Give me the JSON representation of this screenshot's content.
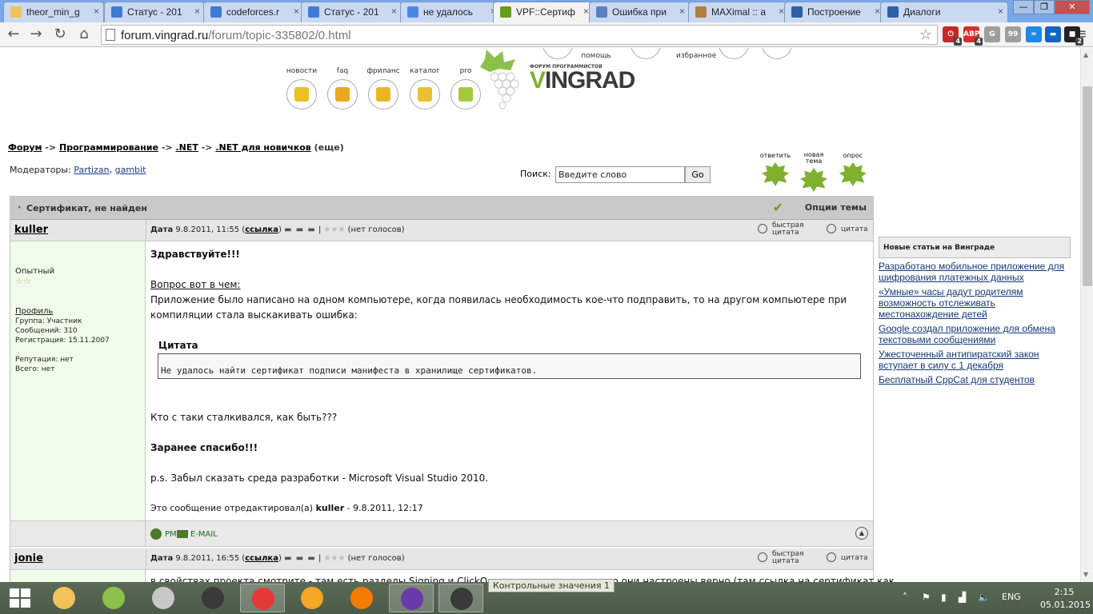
{
  "browser": {
    "tabs": [
      {
        "title": "theor_min_g",
        "color": "#f2c35a"
      },
      {
        "title": "Статус - 201",
        "color": "#3e7bd6"
      },
      {
        "title": "codeforces.r",
        "color": "#3e7bd6"
      },
      {
        "title": "Статус - 201",
        "color": "#3e7bd6"
      },
      {
        "title": "не удалось",
        "color": "#4a87e8"
      },
      {
        "title": "VPF::Сертиф",
        "color": "#6a9a1a"
      },
      {
        "title": "Ошибка при",
        "color": "#5a7fc0"
      },
      {
        "title": "MAXimal :: a",
        "color": "#b08040"
      },
      {
        "title": "Построение",
        "color": "#2e5fa8"
      },
      {
        "title": "Диалоги",
        "color": "#2e5fa8"
      }
    ],
    "active_tab_index": 5,
    "url_host": "forum.vingrad.ru",
    "url_path": "/forum/topic-335802/0.html",
    "extensions": [
      {
        "label": "⏻",
        "badge": "4",
        "color": "#c62828"
      },
      {
        "label": "ABP",
        "badge": "4",
        "color": "#d32f2f"
      },
      {
        "label": "G",
        "badge": "",
        "color": "#9e9e9e"
      },
      {
        "label": "99",
        "badge": "",
        "color": "#9e9e9e"
      },
      {
        "label": "≈",
        "badge": "",
        "color": "#1e88e5"
      },
      {
        "label": "▬",
        "badge": "",
        "color": "#1565c0"
      },
      {
        "label": "■",
        "badge": "2",
        "color": "#222"
      }
    ]
  },
  "header": {
    "top_labels": [
      "помощь",
      "избранное"
    ],
    "nav": [
      {
        "label": "новости",
        "icon": "news-icon",
        "color": "#e9c020"
      },
      {
        "label": "faq",
        "icon": "faq-icon",
        "color": "#e9a820"
      },
      {
        "label": "фриланс",
        "icon": "freelance-icon",
        "color": "#e9b820"
      },
      {
        "label": "каталог",
        "icon": "catalog-icon",
        "color": "#e9c030"
      },
      {
        "label": "pro",
        "icon": "pro-icon",
        "color": "#a6c93a"
      }
    ],
    "logo_sub": "ФОРУМ ПРОГРАММИСТОВ",
    "logo_v": "V",
    "logo_rest": "INGRAD"
  },
  "breadcrumb": {
    "items": [
      "Форум",
      "Программирование",
      ".NET",
      ".NET для новичков"
    ],
    "separator": "->",
    "more": "(еще)"
  },
  "moderators": {
    "label": "Модераторы:",
    "names": [
      "Partizan",
      "gambit"
    ]
  },
  "search": {
    "label": "Поиск:",
    "placeholder": "Введите слово",
    "value": "Введите слово",
    "button": "Go"
  },
  "actions": [
    {
      "label": "ответить"
    },
    {
      "label": "новая тема"
    },
    {
      "label": "опрос"
    }
  ],
  "topic": {
    "title": "Сертификат, не найден",
    "options": "Опции темы"
  },
  "posts": [
    {
      "author": "kuller",
      "date_label": "Дата",
      "date": "9.8.2011, 11:55",
      "link": "ссылка",
      "votes": "(нет голосов)",
      "quick_quote": "быстрая цитата",
      "quote": "цитата",
      "rank": "Опытный",
      "profile": "Профиль",
      "group": "Группа: Участник",
      "messages": "Сообщений: 310",
      "registration": "Регистрация: 15.11.2007",
      "reputation": "Репутация: нет",
      "total": "Всего: нет",
      "greeting": "Здравствуйте!!!",
      "question": "Вопрос вот в чем:",
      "line1": "Приложение было написано на одном компьютере, когда появилась необходимость кое-что подправить, то на другом компьютере при",
      "line2": "компиляции стала выскакивать ошибка:",
      "quote_title": "Цитата",
      "quote_text": "Не удалось найти сертификат подписи манифеста в хранилище сертификатов.",
      "ask": "Кто с таки сталкивался, как быть???",
      "thanks": "Заранее спасибо!!!",
      "ps": "p.s. Забыл сказать среда разработки - Microsoft Visual Studio 2010.",
      "edited_prefix": "Это сообщение отредактировал(а)",
      "edited_user": "kuller",
      "edited_date": "- 9.8.2011, 12:17",
      "pm": "PM",
      "email": "E-MAIL"
    },
    {
      "author": "jonie",
      "date_label": "Дата",
      "date": "9.8.2011, 16:55",
      "link": "ссылка",
      "votes": "(нет голосов)",
      "quick_quote": "быстрая цитата",
      "quote": "цитата",
      "snippet": "в свойствах проекта смотрите - там есть разделы Signing и ClickOnce - удостоверьтесь, что они настроены верно (там ссылка на сертификат как"
    }
  ],
  "sidebar": {
    "title": "Новые статьи на Винграде",
    "articles": [
      "Разработано мобильное приложение для шифрования платежных данных",
      "«Умные» часы дадут родителям возможность отслеживать местонахождение детей",
      "Google создал приложение для обмена текстовыми сообщениями",
      "Ужесточенный антипиратский закон вступает в силу с 1 декабря",
      "Бесплатный CppCat для студентов"
    ]
  },
  "taskbar": {
    "apps": [
      {
        "name": "explorer-icon",
        "color": "#f2c35a"
      },
      {
        "name": "photos-icon",
        "color": "#8cc04a"
      },
      {
        "name": "drive-icon",
        "color": "#c8c8c8"
      },
      {
        "name": "camera-icon",
        "color": "#3a3a3a"
      },
      {
        "name": "chrome-icon",
        "color": "#e53935"
      },
      {
        "name": "aimp-icon",
        "color": "#f5a623"
      },
      {
        "name": "vlc-icon",
        "color": "#f57c00"
      },
      {
        "name": "visual-studio-icon",
        "color": "#6a3aa8"
      },
      {
        "name": "camera2-icon",
        "color": "#3a3a3a"
      }
    ],
    "active_indexes": [
      4,
      7,
      8
    ],
    "tooltip": "Контрольные значения 1",
    "lang": "ENG",
    "time": "2:15",
    "date": "05.01.2015"
  }
}
